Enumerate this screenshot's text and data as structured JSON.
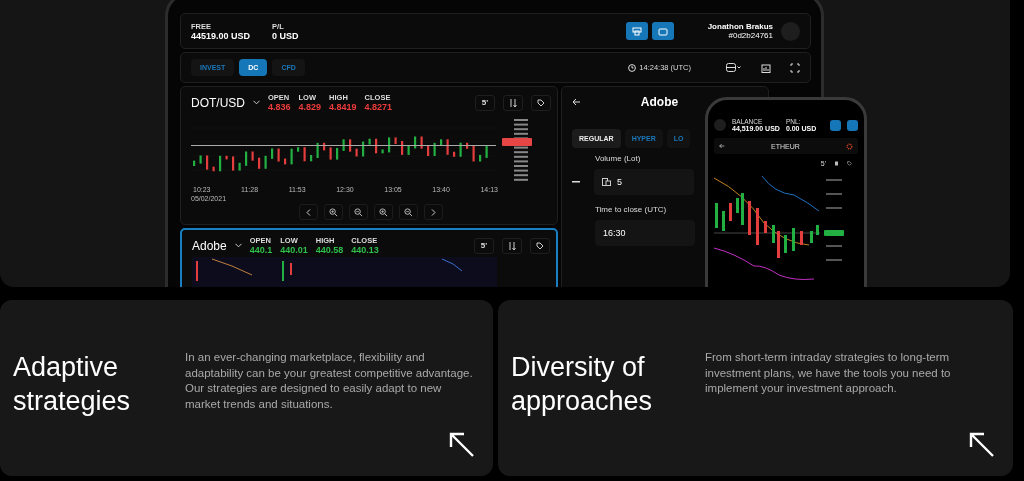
{
  "account": {
    "free_label": "FREE",
    "free_value": "44519.00 USD",
    "pl_label": "P/L",
    "pl_value": "0 USD",
    "user_name": "Jonathon Brakus",
    "user_id": "#0d2b24761"
  },
  "mode_tabs": [
    {
      "label": "INVEST",
      "selected": false
    },
    {
      "label": "DC",
      "selected": true
    },
    {
      "label": "CFD",
      "selected": false
    }
  ],
  "clock": "14:24:38 (UTC)",
  "charts": [
    {
      "symbol": "DOT/USD",
      "color": "#ee3b3b",
      "focused": false,
      "interval": "5'",
      "stats": [
        {
          "label": "OPEN",
          "value": "4.836"
        },
        {
          "label": "LOW",
          "value": "4.829"
        },
        {
          "label": "HIGH",
          "value": "4.8419"
        },
        {
          "label": "CLOSE",
          "value": "4.8271"
        }
      ],
      "x_labels": [
        "10:23",
        "11:28",
        "11:53",
        "12:30",
        "13:05",
        "13:40",
        "14:13"
      ],
      "date": "05/02/2021"
    },
    {
      "symbol": "Adobe",
      "color": "#2fbf4a",
      "focused": true,
      "interval": "5'",
      "stats": [
        {
          "label": "OPEN",
          "value": "440.1"
        },
        {
          "label": "LOW",
          "value": "440.01"
        },
        {
          "label": "HIGH",
          "value": "440.58"
        },
        {
          "label": "CLOSE",
          "value": "440.13"
        }
      ]
    }
  ],
  "order": {
    "title": "Adobe",
    "types": [
      {
        "label": "REGULAR",
        "selected": true
      },
      {
        "label": "HYPER",
        "selected": false
      },
      {
        "label": "LO",
        "selected": false
      }
    ],
    "volume_label": "Volume (Lot)",
    "volume": "5",
    "time_label": "Time to close (UTC)",
    "time": "16:30"
  },
  "phone": {
    "balance_label": "BALANCE",
    "balance": "44,519.00 USD",
    "pnl_label": "PNL:",
    "pnl": "0.00 USD",
    "symbol": "ETHEUR",
    "interval": "5'"
  },
  "features": [
    {
      "title": "Adaptive strategies",
      "text": "In an ever-changing marketplace, flexibility and adaptability can be your greatest competitive advantage. Our strategies are designed to easily adapt to new market trends and situations."
    },
    {
      "title": "Diversity of approaches",
      "text": "From short-term intraday strategies to long-term investment plans, we have the tools you need to implement your investment approach."
    }
  ]
}
